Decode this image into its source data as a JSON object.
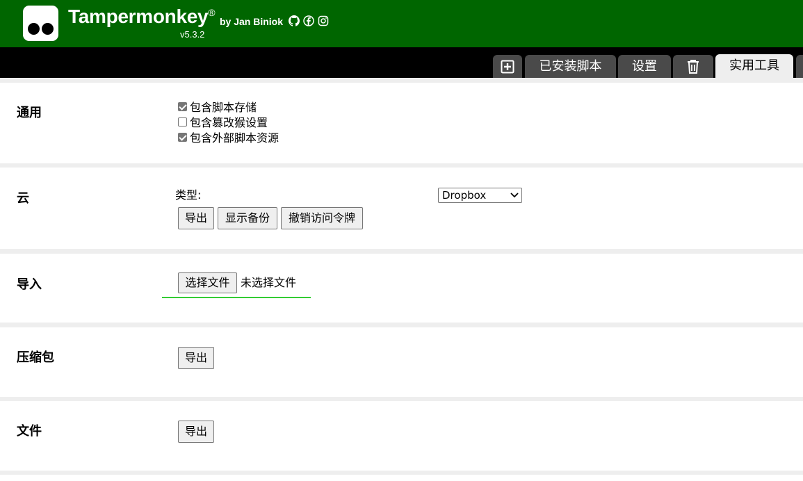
{
  "header": {
    "app_name": "Tampermonkey",
    "registered": "®",
    "byline": "by Jan Biniok",
    "version": "v5.3.2",
    "bg_color": "#006600"
  },
  "tabs": [
    {
      "label": "",
      "icon": "plus-square-icon"
    },
    {
      "label": "已安装脚本"
    },
    {
      "label": "设置"
    },
    {
      "label": "",
      "icon": "trash-icon"
    },
    {
      "label": "实用工具",
      "active": true
    }
  ],
  "sections": {
    "general": {
      "title": "通用",
      "options": [
        {
          "label": "包含脚本存储",
          "checked": true
        },
        {
          "label": "包含篡改猴设置",
          "checked": false
        },
        {
          "label": "包含外部脚本资源",
          "checked": true
        }
      ]
    },
    "cloud": {
      "title": "云",
      "type_label": "类型:",
      "type_value": "Dropbox",
      "export_button": "导出",
      "show_backups_button": "显示备份",
      "revoke_button": "撤销访问令牌"
    },
    "import": {
      "title": "导入",
      "choose_file_button": "选择文件",
      "no_file_text": "未选择文件"
    },
    "zip": {
      "title": "压缩包",
      "export_button": "导出"
    },
    "file": {
      "title": "文件",
      "export_button": "导出"
    }
  }
}
